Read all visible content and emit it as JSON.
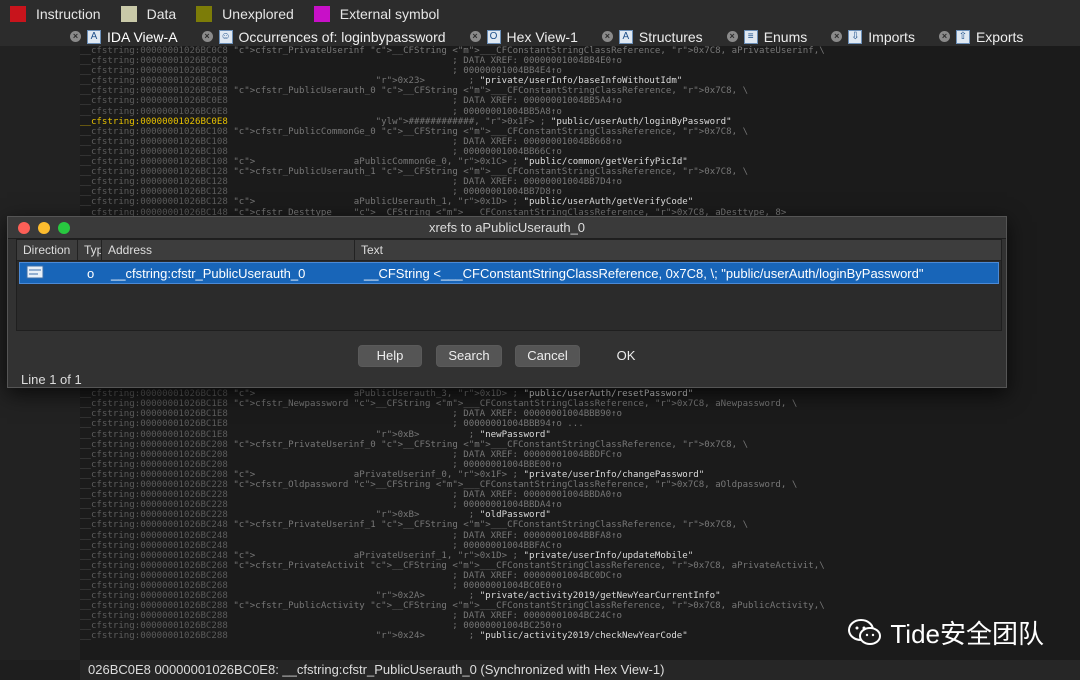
{
  "legend": [
    {
      "label": "Instruction",
      "color": "#c8141c"
    },
    {
      "label": "Data",
      "color": "#c9c9a8"
    },
    {
      "label": "Unexplored",
      "color": "#7c7c08"
    },
    {
      "label": "External symbol",
      "color": "#c810c8"
    }
  ],
  "tabs": [
    {
      "label": "IDA View-A",
      "icon": "ida-view-icon",
      "glyph": "A"
    },
    {
      "label": "Occurrences of: loginbypassword",
      "icon": "person-icon",
      "glyph": "☺"
    },
    {
      "label": "Hex View-1",
      "icon": "hex-view-icon",
      "glyph": "O"
    },
    {
      "label": "Structures",
      "icon": "structures-icon",
      "glyph": "A"
    },
    {
      "label": "Enums",
      "icon": "enums-icon",
      "glyph": "≡"
    },
    {
      "label": "Imports",
      "icon": "imports-icon",
      "glyph": "⇩"
    },
    {
      "label": "Exports",
      "icon": "exports-icon",
      "glyph": "⇧"
    }
  ],
  "listing": [
    {
      "addr": "__cfstring:00000001026BC0C8",
      "code": "cfstr_PrivateUserinf __CFString <___CFConstantStringClassReference, 0x7C8, aPrivateUserinf,\\"
    },
    {
      "addr": "__cfstring:00000001026BC0C8",
      "code": "                                        ; DATA XREF: 00000001004BB4E0↑o"
    },
    {
      "addr": "__cfstring:00000001026BC0C8",
      "code": "                                        ; 00000001004BB4E4↑o"
    },
    {
      "addr": "__cfstring:00000001026BC0C8",
      "code": "                          0x23>        ; \"private/userInfo/baseInfoWithoutIdm\""
    },
    {
      "addr": "__cfstring:00000001026BC0E8",
      "code": "cfstr_PublicUserauth_0 __CFString <___CFConstantStringClassReference, 0x7C8, \\"
    },
    {
      "addr": "__cfstring:00000001026BC0E8",
      "code": "                                        ; DATA XREF: 00000001004BB5A4↑o"
    },
    {
      "addr": "__cfstring:00000001026BC0E8",
      "code": "                                        ; 00000001004BB5A8↑o"
    },
    {
      "addr": "__cfstring:00000001026BC0E8",
      "code": "                          ############, 0x1F> ; \"public/userAuth/loginByPassword\"",
      "hl": true
    },
    {
      "addr": "__cfstring:00000001026BC108",
      "code": "cfstr_PublicCommonGe_0 __CFString <___CFConstantStringClassReference, 0x7C8, \\"
    },
    {
      "addr": "__cfstring:00000001026BC108",
      "code": "                                        ; DATA XREF: 00000001004BB668↑o"
    },
    {
      "addr": "__cfstring:00000001026BC108",
      "code": "                                        ; 00000001004BB66C↑o"
    },
    {
      "addr": "__cfstring:00000001026BC108",
      "code": "                  aPublicCommonGe_0, 0x1C> ; \"public/common/getVerifyPicId\""
    },
    {
      "addr": "__cfstring:00000001026BC128",
      "code": "cfstr_PublicUserauth_1 __CFString <___CFConstantStringClassReference, 0x7C8, \\"
    },
    {
      "addr": "__cfstring:00000001026BC128",
      "code": "                                        ; DATA XREF: 00000001004BB7D4↑o"
    },
    {
      "addr": "__cfstring:00000001026BC128",
      "code": "                                        ; 00000001004BB7D8↑o"
    },
    {
      "addr": "__cfstring:00000001026BC128",
      "code": "                  aPublicUserauth_1, 0x1D> ; \"public/userAuth/getVerifyCode\""
    },
    {
      "addr": "__cfstring:00000001026BC148",
      "code": "cfstr_Desttype    __CFString <___CFConstantStringClassReference, 0x7C8, aDesttype, 8>"
    },
    {
      "addr": "",
      "code": ""
    },
    {
      "addr": "",
      "code": ""
    },
    {
      "addr": "",
      "code": ""
    },
    {
      "addr": "",
      "code": ""
    },
    {
      "addr": "",
      "code": ""
    },
    {
      "addr": "",
      "code": ""
    },
    {
      "addr": "",
      "code": ""
    },
    {
      "addr": "",
      "code": ""
    },
    {
      "addr": "",
      "code": ""
    },
    {
      "addr": "",
      "code": ""
    },
    {
      "addr": "",
      "code": ""
    },
    {
      "addr": "",
      "code": ""
    },
    {
      "addr": "",
      "code": ""
    },
    {
      "addr": "",
      "code": ""
    },
    {
      "addr": "",
      "code": ""
    },
    {
      "addr": "",
      "code": ""
    },
    {
      "addr": "__cfstring:00000001026BC1C8",
      "code": "                                        ; 00000001004BBC20↑o"
    },
    {
      "addr": "__cfstring:00000001026BC1C8",
      "code": "                  aPublicUserauth_3, 0x1D> ; \"public/userAuth/resetPassword\""
    },
    {
      "addr": "__cfstring:00000001026BC1E8",
      "code": "cfstr_Newpassword __CFString <___CFConstantStringClassReference, 0x7C8, aNewpassword, \\"
    },
    {
      "addr": "__cfstring:00000001026BC1E8",
      "code": "                                        ; DATA XREF: 00000001004BBB90↑o"
    },
    {
      "addr": "__cfstring:00000001026BC1E8",
      "code": "                                        ; 00000001004BBB94↑o ..."
    },
    {
      "addr": "__cfstring:00000001026BC1E8",
      "code": "                          0xB>         ; \"newPassword\""
    },
    {
      "addr": "__cfstring:00000001026BC208",
      "code": "cfstr_PrivateUserinf_0 __CFString <___CFConstantStringClassReference, 0x7C8, \\"
    },
    {
      "addr": "__cfstring:00000001026BC208",
      "code": "                                        ; DATA XREF: 00000001004BBDFC↑o"
    },
    {
      "addr": "__cfstring:00000001026BC208",
      "code": "                                        ; 00000001004BBE00↑o"
    },
    {
      "addr": "__cfstring:00000001026BC208",
      "code": "                  aPrivateUserinf_0, 0x1F> ; \"private/userInfo/changePassword\""
    },
    {
      "addr": "__cfstring:00000001026BC228",
      "code": "cfstr_Oldpassword __CFString <___CFConstantStringClassReference, 0x7C8, aOldpassword, \\"
    },
    {
      "addr": "__cfstring:00000001026BC228",
      "code": "                                        ; DATA XREF: 00000001004BBDA0↑o"
    },
    {
      "addr": "__cfstring:00000001026BC228",
      "code": "                                        ; 00000001004BBDA4↑o"
    },
    {
      "addr": "__cfstring:00000001026BC228",
      "code": "                          0xB>         ; \"oldPassword\""
    },
    {
      "addr": "__cfstring:00000001026BC248",
      "code": "cfstr_PrivateUserinf_1 __CFString <___CFConstantStringClassReference, 0x7C8, \\"
    },
    {
      "addr": "__cfstring:00000001026BC248",
      "code": "                                        ; DATA XREF: 00000001004BBFA8↑o"
    },
    {
      "addr": "__cfstring:00000001026BC248",
      "code": "                                        ; 00000001004BBFAC↑o"
    },
    {
      "addr": "__cfstring:00000001026BC248",
      "code": "                  aPrivateUserinf_1, 0x1D> ; \"private/userInfo/updateMobile\""
    },
    {
      "addr": "__cfstring:00000001026BC268",
      "code": "cfstr_PrivateActivit __CFString <___CFConstantStringClassReference, 0x7C8, aPrivateActivit,\\"
    },
    {
      "addr": "__cfstring:00000001026BC268",
      "code": "                                        ; DATA XREF: 00000001004BC0DC↑o"
    },
    {
      "addr": "__cfstring:00000001026BC268",
      "code": "                                        ; 00000001004BC0E0↑o"
    },
    {
      "addr": "__cfstring:00000001026BC268",
      "code": "                          0x2A>        ; \"private/activity2019/getNewYearCurrentInfo\""
    },
    {
      "addr": "__cfstring:00000001026BC288",
      "code": "cfstr_PublicActivity __CFString <___CFConstantStringClassReference, 0x7C8, aPublicActivity,\\"
    },
    {
      "addr": "__cfstring:00000001026BC288",
      "code": "                                        ; DATA XREF: 00000001004BC24C↑o"
    },
    {
      "addr": "__cfstring:00000001026BC288",
      "code": "                                        ; 00000001004BC250↑o"
    },
    {
      "addr": "__cfstring:00000001026BC288",
      "code": "                          0x24>        ; \"public/activity2019/checkNewYearCode\""
    }
  ],
  "dialog": {
    "title": "xrefs to aPublicUserauth_0",
    "columns": {
      "direction": "Direction",
      "type": "Typ",
      "address": "Address",
      "text": "Text"
    },
    "row": {
      "direction_icon": "xref-direction-icon",
      "type": "o",
      "address": "__cfstring:cfstr_PublicUserauth_0",
      "text": "__CFString <___CFConstantStringClassReference, 0x7C8, \\; \"public/userAuth/loginByPassword\""
    },
    "buttons": {
      "help": "Help",
      "search": "Search",
      "cancel": "Cancel",
      "ok": "OK"
    },
    "status": "Line 1 of 1"
  },
  "status_bar": "026BC0E8 00000001026BC0E8: __cfstring:cfstr_PublicUserauth_0 (Synchronized with Hex View-1)",
  "watermark": "Tide安全团队"
}
